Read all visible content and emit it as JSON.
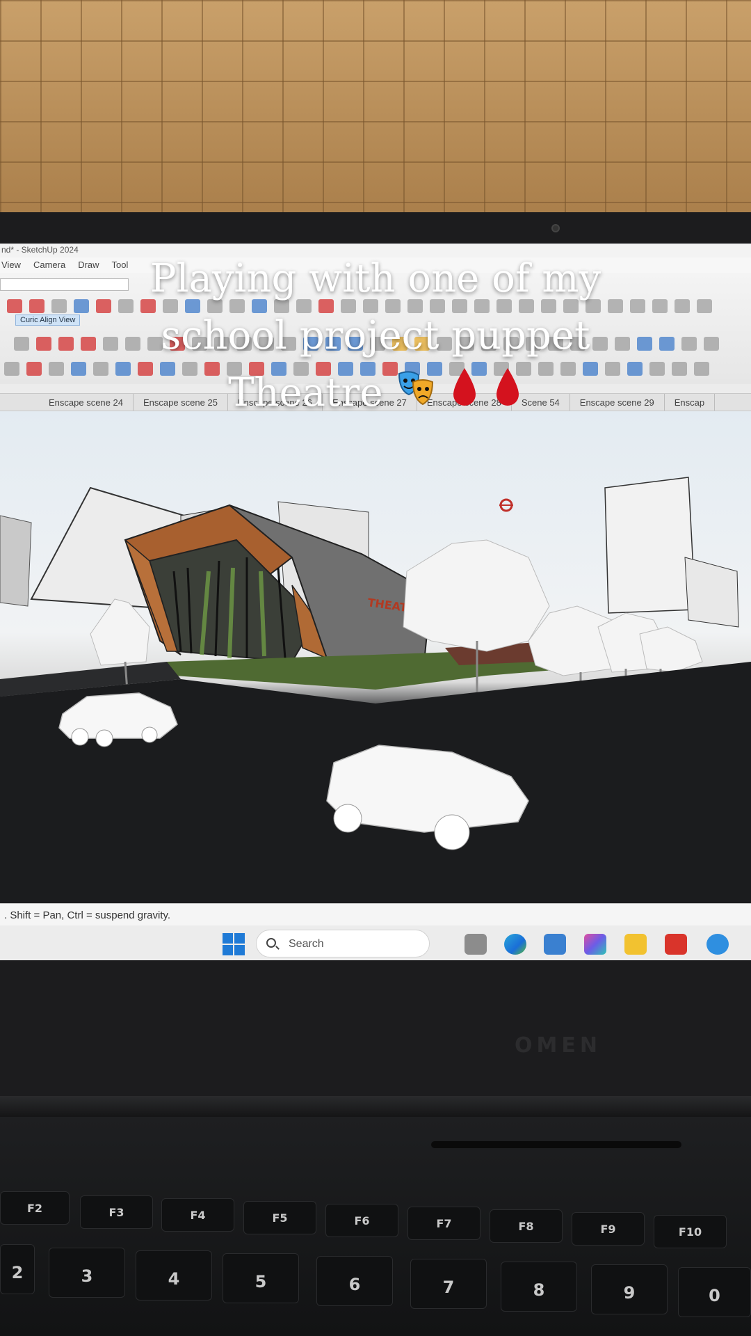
{
  "caption": {
    "text": "Playing with one of my school project puppet Theatre"
  },
  "emojis": [
    "performing-arts-icon",
    "blood-drop-icon",
    "blood-drop-icon"
  ],
  "app": {
    "title": "nd* - SketchUp 2024",
    "menu": [
      "View",
      "Camera",
      "Draw",
      "Tool"
    ],
    "align_view_label": "Curic Align View",
    "scene_tabs": [
      "Enscape scene 24",
      "Enscape scene 25",
      "Enscape scene 26",
      "Enscape scene 27",
      "Enscape scene 28",
      "Scene 54",
      "Enscape scene 29",
      "Enscap"
    ],
    "status_text": ". Shift = Pan, Ctrl = suspend gravity.",
    "sign_text": "THEATER"
  },
  "taskbar": {
    "search_label": "Search",
    "apps": [
      "start-icon",
      "task-view-icon",
      "edge-icon",
      "store-icon",
      "copilot-icon",
      "file-explorer-icon",
      "wps-icon",
      "help-icon"
    ]
  },
  "laptop": {
    "brand": "OMEN"
  },
  "keyboard": {
    "fn_row": [
      "F2",
      "F3",
      "F4",
      "F5",
      "F6",
      "F7",
      "F8",
      "F9",
      "F10"
    ],
    "num_row": [
      "2",
      "3",
      "4",
      "5",
      "6",
      "7",
      "8",
      "9",
      "0"
    ]
  },
  "colors": {
    "accent_copper": "#a8602f",
    "screen_bg": "#ececec",
    "wall": "#b98e58"
  }
}
